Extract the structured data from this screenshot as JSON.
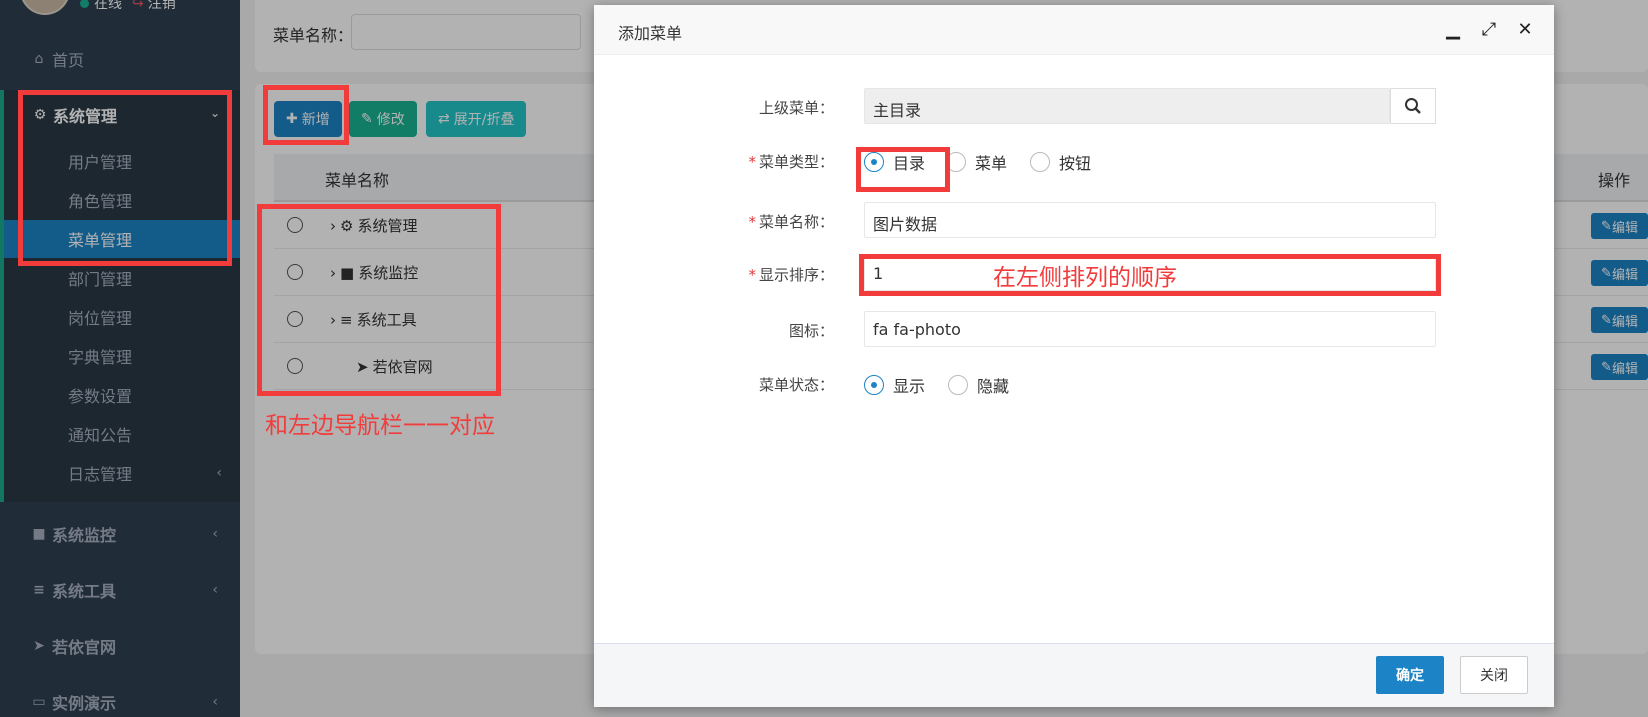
{
  "sidebar": {
    "user_status": "在线",
    "logout": "注销",
    "home": "首页",
    "group": {
      "title": "系统管理",
      "items": [
        "用户管理",
        "角色管理",
        "菜单管理",
        "部门管理",
        "岗位管理",
        "字典管理",
        "参数设置",
        "通知公告",
        "日志管理"
      ]
    },
    "nav": [
      "系统监控",
      "系统工具",
      "若依官网",
      "实例演示"
    ]
  },
  "search": {
    "label": "菜单名称："
  },
  "toolbar": {
    "add": "新增",
    "edit": "修改",
    "expand": "展开/折叠"
  },
  "table": {
    "col_name": "菜单名称",
    "col_op": "操作",
    "rows": [
      "系统管理",
      "系统监控",
      "系统工具",
      "若依官网"
    ],
    "edit_label": "编辑"
  },
  "dialog": {
    "title": "添加菜单",
    "parent_label": "上级菜单：",
    "parent_value": "主目录",
    "type_label": "菜单类型：",
    "type_options": [
      "目录",
      "菜单",
      "按钮"
    ],
    "type_selected": "目录",
    "name_label": "菜单名称：",
    "name_value": "图片数据",
    "order_label": "显示排序：",
    "order_value": "1",
    "icon_label": "图标：",
    "icon_value": "fa fa-photo",
    "status_label": "菜单状态：",
    "status_options": [
      "显示",
      "隐藏"
    ],
    "status_selected": "显示",
    "ok": "确定",
    "close": "关闭"
  },
  "annotations": {
    "table_note": "和左边导航栏一一对应",
    "order_note": "在左侧排列的顺序"
  },
  "colors": {
    "sidebar": "#2f4050",
    "primary": "#1c84c6",
    "success": "#1ab394",
    "info": "#23c6c8",
    "highlight": "#f23c3c"
  }
}
